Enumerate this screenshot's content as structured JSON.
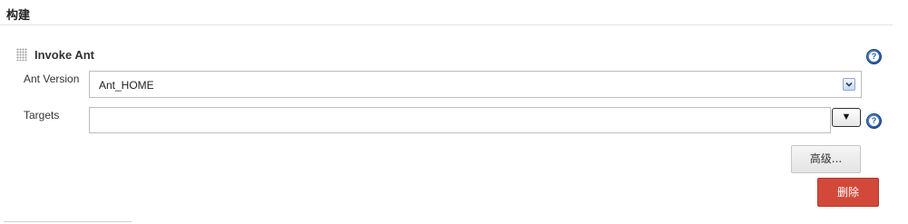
{
  "section": {
    "title": "构建"
  },
  "step": {
    "title": "Invoke Ant",
    "icons": {
      "drag": "drag-handle-icon",
      "help": "help-icon"
    }
  },
  "fields": {
    "ant_version": {
      "label": "Ant Version",
      "selected": "Ant_HOME"
    },
    "targets": {
      "label": "Targets",
      "value": "",
      "expand_label": "▼"
    }
  },
  "buttons": {
    "advanced_label": "高级...",
    "delete_label": "删除"
  },
  "help_glyph": "?",
  "colors": {
    "delete_bg": "#d24939",
    "help_blue": "#2a5fa8",
    "border": "#bdbdbd"
  }
}
